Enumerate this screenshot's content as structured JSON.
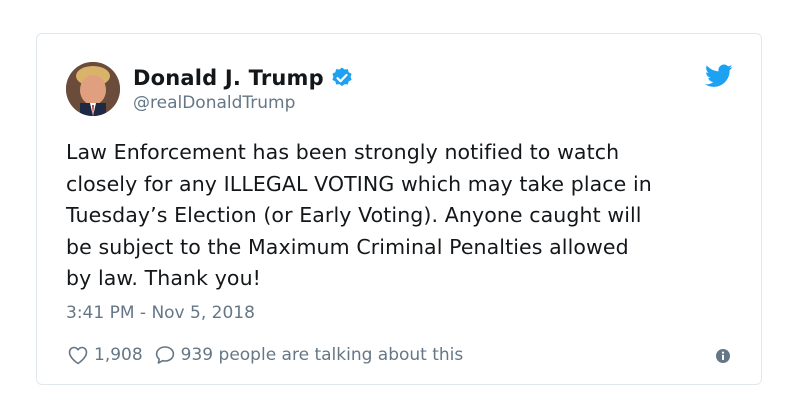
{
  "author": {
    "name": "Donald J. Trump",
    "handle": "@realDonaldTrump",
    "verified": true
  },
  "tweet": {
    "lines": [
      "Law Enforcement has been strongly notified to watch",
      "closely for any ILLEGAL VOTING which may take place in",
      "Tuesday’s Election (or Early Voting). Anyone caught will",
      "be subject to the Maximum Criminal Penalties allowed",
      "by law. Thank you!"
    ],
    "timestamp": "3:41 PM - Nov 5, 2018"
  },
  "engagement": {
    "likes": "1,908",
    "talking": "939 people are talking about this"
  },
  "icons": {
    "verified": "verified-badge-icon",
    "bird": "twitter-bird-icon",
    "like": "heart-icon",
    "reply": "speech-bubble-icon",
    "info": "info-icon"
  },
  "colors": {
    "brand": "#1da1f2",
    "text": "#14171a",
    "muted": "#657786",
    "border": "#e1e8ed"
  }
}
